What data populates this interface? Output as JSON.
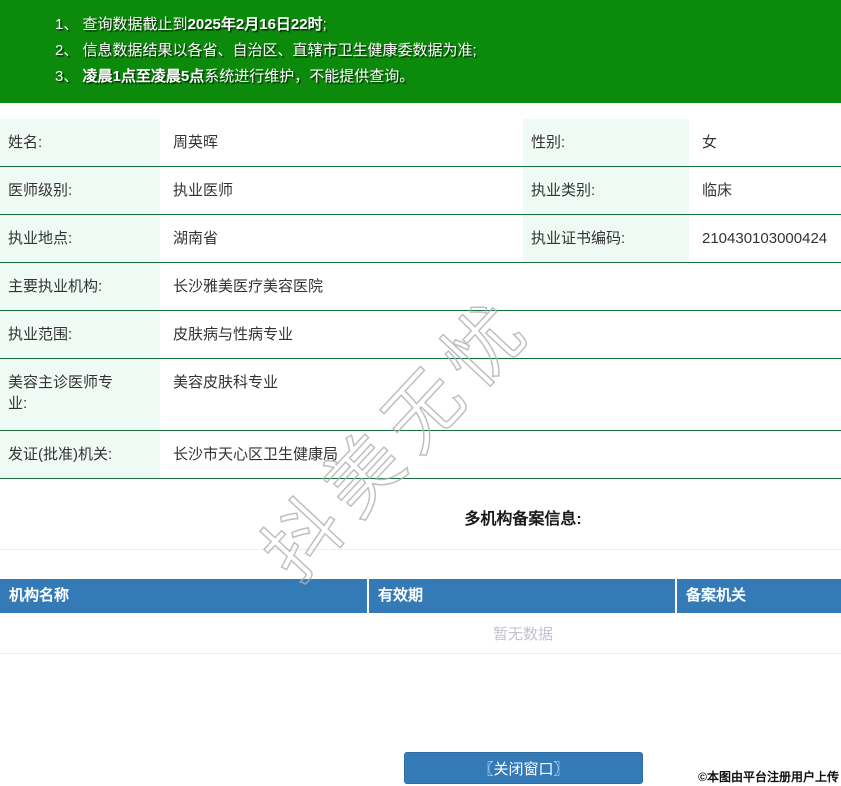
{
  "notice": {
    "lines": [
      {
        "pre": "1、 查询数据截止到",
        "bold": "2025年2月16日22时",
        "post": ";"
      },
      {
        "pre": "2、 信息数据结果以各省、自治区、直辖市卫生健康委数据为准;",
        "bold": "",
        "post": ""
      },
      {
        "pre": "3、 ",
        "bold": "凌晨1点至凌晨5点",
        "post": "系统进行维护，不能提供查询。"
      }
    ]
  },
  "info": {
    "rows": [
      {
        "cells": [
          {
            "label": "姓名:",
            "value": "周英晖"
          },
          {
            "label": "性别:",
            "value": "女"
          }
        ]
      },
      {
        "cells": [
          {
            "label": "医师级别:",
            "value": "执业医师"
          },
          {
            "label": "执业类别:",
            "value": "临床"
          }
        ]
      },
      {
        "cells": [
          {
            "label": "执业地点:",
            "value": "湖南省"
          },
          {
            "label": "执业证书编码:",
            "value": "210430103000424"
          }
        ]
      },
      {
        "cells": [
          {
            "label": "主要执业机构:",
            "value": "长沙雅美医疗美容医院"
          }
        ]
      },
      {
        "cells": [
          {
            "label": "执业范围:",
            "value": "皮肤病与性病专业"
          }
        ]
      },
      {
        "cells": [
          {
            "label": "美容主诊医师专业:",
            "value": "美容皮肤科专业"
          }
        ]
      },
      {
        "cells": [
          {
            "label": "发证(批准)机关:",
            "value": "长沙市天心区卫生健康局"
          }
        ]
      }
    ]
  },
  "multi_org_section": {
    "title": "多机构备案信息:",
    "table": {
      "headers": [
        "机构名称",
        "有效期",
        "备案机关"
      ],
      "empty_text": "暂无数据"
    }
  },
  "watermark": {
    "text": "抖美无忧"
  },
  "footer": {
    "close_button_label": "〖关闭窗口〗",
    "copyright": "©本图由平台注册用户上传"
  },
  "colors": {
    "banner_green": "#0c8a0c",
    "label_cell_green": "#effaf5",
    "row_border_green": "#186e41",
    "table_header_blue": "#337ab7",
    "button_blue": "#337ab7",
    "button_border_blue": "#2e6da4",
    "empty_text_gray": "#c0c4cc"
  }
}
